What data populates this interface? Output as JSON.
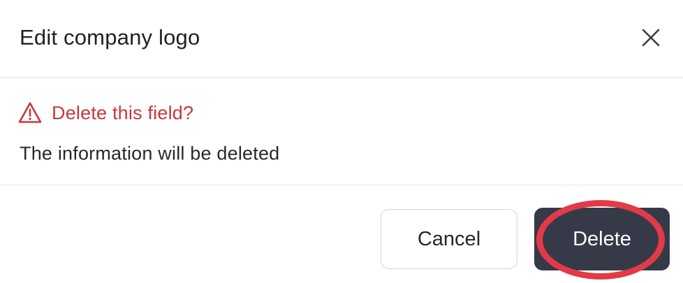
{
  "dialog": {
    "title": "Edit company logo",
    "close_icon": "close-icon"
  },
  "warning": {
    "icon": "warning-triangle-icon",
    "text": "Delete this field?",
    "color": "#c8373a"
  },
  "message": "The information will be deleted",
  "actions": {
    "cancel_label": "Cancel",
    "delete_label": "Delete",
    "delete_bg": "#363a48",
    "highlight_color": "#e23a46"
  }
}
